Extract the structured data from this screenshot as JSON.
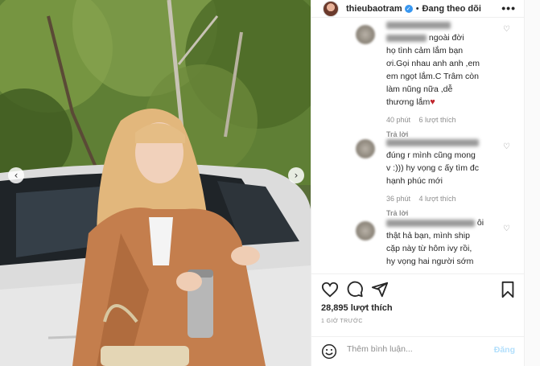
{
  "post": {
    "username": "thieubaotram",
    "separator": "•",
    "follow_status": "Đang theo dõi",
    "more_symbol": "•••"
  },
  "photo": {
    "nav_prev": "‹",
    "nav_next": "›"
  },
  "comments": [
    {
      "username_visible": "",
      "lines": [
        "ngoài đời",
        "họ tình cảm lắm bạn",
        "ơi.Gọi nhau anh anh ,em",
        "em ngọt lắm.C Trâm còn",
        "làm nũng nữa ,dễ",
        "thương lắm"
      ],
      "prefix_text": "",
      "time": "40 phút",
      "likes": "6 lượt thích",
      "reply": "Trả lời"
    },
    {
      "username_visible": "",
      "lines": [
        "đúng r mình cũng mong",
        "v :))) hy vọng c ấy tìm đc",
        "hạnh phúc mới"
      ],
      "time": "36 phút",
      "likes": "4 lượt thích",
      "reply": "Trả lời"
    },
    {
      "username_visible": "",
      "lines": [
        "ôi",
        "thật hả bạn, mình ship",
        "cặp này từ hôm ivy rồi,",
        "hy vọng hai người sớm"
      ],
      "time": "",
      "likes": "",
      "reply": ""
    }
  ],
  "actions": {
    "likes_count": "28,895 lượt thích",
    "time_ago": "1 GIỜ TRƯỚC"
  },
  "composer": {
    "placeholder": "Thêm bình luận...",
    "post_label": "Đăng"
  },
  "colors": {
    "accent": "#3897f0",
    "heart": "#c0262d",
    "post_disabled": "#b2dffc",
    "meta_gray": "#8e8e8e"
  }
}
